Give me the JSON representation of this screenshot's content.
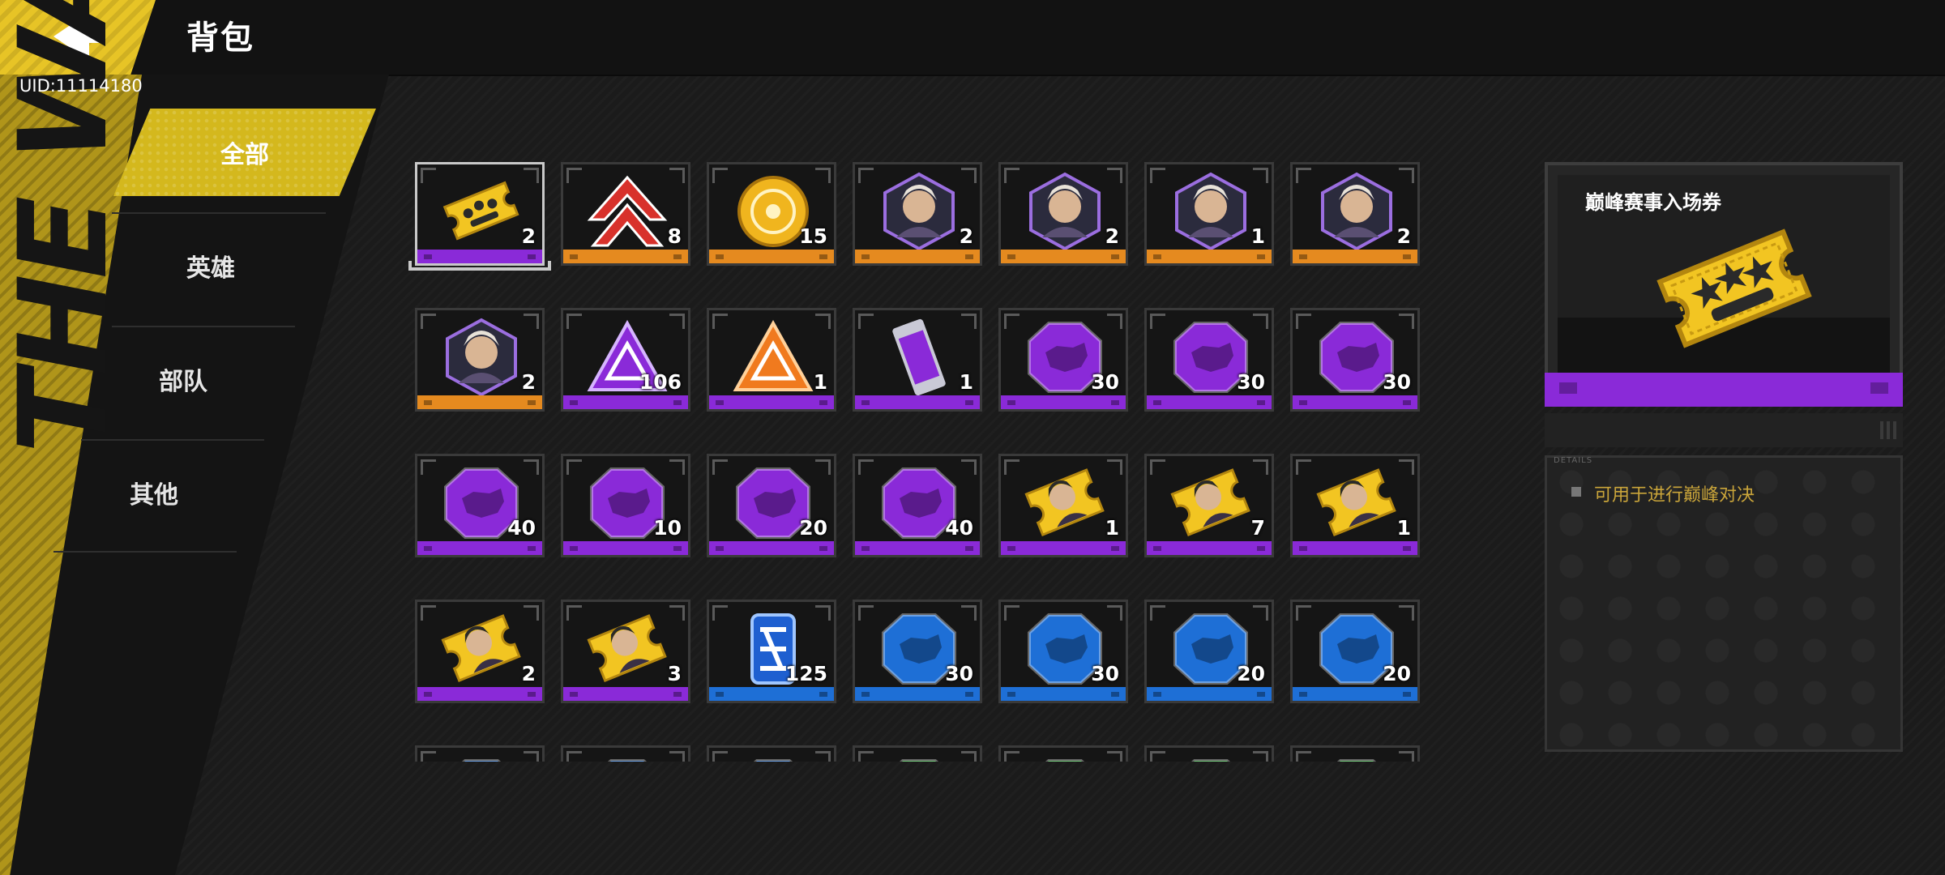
{
  "header": {
    "title": "背包",
    "uid": "UID:11114180"
  },
  "brand_text": "THE WAR",
  "nav": {
    "items": [
      {
        "label": "全部",
        "active": true
      },
      {
        "label": "英雄",
        "active": false
      },
      {
        "label": "部队",
        "active": false
      },
      {
        "label": "其他",
        "active": false
      }
    ]
  },
  "colors": {
    "accent": "#d4b81d",
    "rarity_purple": "#8a2ad8",
    "rarity_orange": "#e58a1f",
    "rarity_blue": "#1e6fd6",
    "rarity_green": "#2fb43a",
    "description_text": "#caa53a"
  },
  "inventory": {
    "rows": [
      [
        {
          "icon": "gold-ticket-icon",
          "qty": "2",
          "rarity": "purple",
          "selected": true
        },
        {
          "icon": "red-chevron-rank-icon",
          "qty": "8",
          "rarity": "orange"
        },
        {
          "icon": "gold-coin-icon",
          "qty": "15",
          "rarity": "orange"
        },
        {
          "icon": "hero-portrait-icon",
          "qty": "2",
          "rarity": "orange"
        },
        {
          "icon": "hero-portrait-icon",
          "qty": "2",
          "rarity": "orange"
        },
        {
          "icon": "hero-portrait-icon",
          "qty": "1",
          "rarity": "orange"
        },
        {
          "icon": "hero-portrait-icon",
          "qty": "2",
          "rarity": "orange"
        }
      ],
      [
        {
          "icon": "hero-portrait-icon",
          "qty": "2",
          "rarity": "orange"
        },
        {
          "icon": "purple-triangle-icon",
          "qty": "106",
          "rarity": "purple"
        },
        {
          "icon": "orange-triangle-icon",
          "qty": "1",
          "rarity": "purple"
        },
        {
          "icon": "purple-capsule-icon",
          "qty": "1",
          "rarity": "purple"
        },
        {
          "icon": "purple-unit-badge-icon",
          "qty": "30",
          "rarity": "purple"
        },
        {
          "icon": "purple-unit-badge-icon",
          "qty": "30",
          "rarity": "purple"
        },
        {
          "icon": "purple-unit-badge-icon",
          "qty": "30",
          "rarity": "purple"
        }
      ],
      [
        {
          "icon": "purple-unit-badge-icon",
          "qty": "40",
          "rarity": "purple"
        },
        {
          "icon": "purple-unit-badge-icon",
          "qty": "10",
          "rarity": "purple"
        },
        {
          "icon": "purple-unit-badge-icon",
          "qty": "20",
          "rarity": "purple"
        },
        {
          "icon": "purple-unit-badge-icon",
          "qty": "40",
          "rarity": "purple"
        },
        {
          "icon": "hero-ticket-icon",
          "qty": "1",
          "rarity": "purple"
        },
        {
          "icon": "hero-ticket-icon",
          "qty": "7",
          "rarity": "purple"
        },
        {
          "icon": "hero-ticket-icon",
          "qty": "1",
          "rarity": "purple"
        }
      ],
      [
        {
          "icon": "hero-ticket-icon",
          "qty": "2",
          "rarity": "purple"
        },
        {
          "icon": "hero-ticket-icon",
          "qty": "3",
          "rarity": "purple"
        },
        {
          "icon": "blue-emblem-icon",
          "qty": "125",
          "rarity": "blue"
        },
        {
          "icon": "blue-unit-badge-icon",
          "qty": "30",
          "rarity": "blue"
        },
        {
          "icon": "blue-unit-badge-icon",
          "qty": "30",
          "rarity": "blue"
        },
        {
          "icon": "blue-unit-badge-icon",
          "qty": "20",
          "rarity": "blue"
        },
        {
          "icon": "blue-unit-badge-icon",
          "qty": "20",
          "rarity": "blue"
        }
      ],
      [
        {
          "icon": "blue-unit-badge-icon",
          "qty": "",
          "rarity": "blue"
        },
        {
          "icon": "blue-unit-badge-icon",
          "qty": "",
          "rarity": "blue"
        },
        {
          "icon": "blue-unit-badge-icon",
          "qty": "",
          "rarity": "blue"
        },
        {
          "icon": "green-unit-badge-icon",
          "qty": "",
          "rarity": "green"
        },
        {
          "icon": "green-unit-badge-icon",
          "qty": "",
          "rarity": "green"
        },
        {
          "icon": "green-unit-badge-icon",
          "qty": "",
          "rarity": "green"
        },
        {
          "icon": "green-unit-badge-icon",
          "qty": "",
          "rarity": "green"
        }
      ]
    ]
  },
  "detail": {
    "name": "巅峰赛事入场券",
    "icon": "gold-ticket-icon",
    "section_label": "DETAILS",
    "description": "可用于进行巅峰对决"
  }
}
